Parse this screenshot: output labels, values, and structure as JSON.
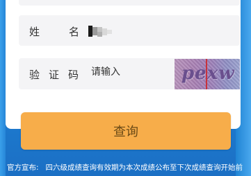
{
  "form": {
    "name_label_1": "姓",
    "name_label_2": "名",
    "captcha_label_1": "验",
    "captcha_label_2": "证",
    "captcha_label_3": "码",
    "captcha_placeholder": "请输入",
    "captcha_image_text": "pexw",
    "name_value_state": "blurred / redacted"
  },
  "buttons": {
    "query_label": "查询"
  },
  "notice": {
    "prefix": "官方宣布:",
    "text": "四六级成绩查询有效期为本次成绩公布至下次成绩查询开始前"
  },
  "colors": {
    "background_blue": "#1e7fd3",
    "button_orange": "#f7ad4a",
    "field_gray": "#f4f4f6"
  }
}
